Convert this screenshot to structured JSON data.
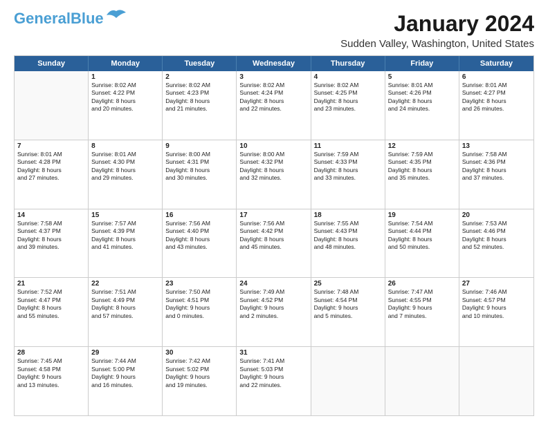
{
  "logo": {
    "line1": "General",
    "line2": "Blue"
  },
  "title": "January 2024",
  "location": "Sudden Valley, Washington, United States",
  "days_of_week": [
    "Sunday",
    "Monday",
    "Tuesday",
    "Wednesday",
    "Thursday",
    "Friday",
    "Saturday"
  ],
  "weeks": [
    [
      {
        "day": "",
        "info": ""
      },
      {
        "day": "1",
        "info": "Sunrise: 8:02 AM\nSunset: 4:22 PM\nDaylight: 8 hours\nand 20 minutes."
      },
      {
        "day": "2",
        "info": "Sunrise: 8:02 AM\nSunset: 4:23 PM\nDaylight: 8 hours\nand 21 minutes."
      },
      {
        "day": "3",
        "info": "Sunrise: 8:02 AM\nSunset: 4:24 PM\nDaylight: 8 hours\nand 22 minutes."
      },
      {
        "day": "4",
        "info": "Sunrise: 8:02 AM\nSunset: 4:25 PM\nDaylight: 8 hours\nand 23 minutes."
      },
      {
        "day": "5",
        "info": "Sunrise: 8:01 AM\nSunset: 4:26 PM\nDaylight: 8 hours\nand 24 minutes."
      },
      {
        "day": "6",
        "info": "Sunrise: 8:01 AM\nSunset: 4:27 PM\nDaylight: 8 hours\nand 26 minutes."
      }
    ],
    [
      {
        "day": "7",
        "info": "Sunrise: 8:01 AM\nSunset: 4:28 PM\nDaylight: 8 hours\nand 27 minutes."
      },
      {
        "day": "8",
        "info": "Sunrise: 8:01 AM\nSunset: 4:30 PM\nDaylight: 8 hours\nand 29 minutes."
      },
      {
        "day": "9",
        "info": "Sunrise: 8:00 AM\nSunset: 4:31 PM\nDaylight: 8 hours\nand 30 minutes."
      },
      {
        "day": "10",
        "info": "Sunrise: 8:00 AM\nSunset: 4:32 PM\nDaylight: 8 hours\nand 32 minutes."
      },
      {
        "day": "11",
        "info": "Sunrise: 7:59 AM\nSunset: 4:33 PM\nDaylight: 8 hours\nand 33 minutes."
      },
      {
        "day": "12",
        "info": "Sunrise: 7:59 AM\nSunset: 4:35 PM\nDaylight: 8 hours\nand 35 minutes."
      },
      {
        "day": "13",
        "info": "Sunrise: 7:58 AM\nSunset: 4:36 PM\nDaylight: 8 hours\nand 37 minutes."
      }
    ],
    [
      {
        "day": "14",
        "info": "Sunrise: 7:58 AM\nSunset: 4:37 PM\nDaylight: 8 hours\nand 39 minutes."
      },
      {
        "day": "15",
        "info": "Sunrise: 7:57 AM\nSunset: 4:39 PM\nDaylight: 8 hours\nand 41 minutes."
      },
      {
        "day": "16",
        "info": "Sunrise: 7:56 AM\nSunset: 4:40 PM\nDaylight: 8 hours\nand 43 minutes."
      },
      {
        "day": "17",
        "info": "Sunrise: 7:56 AM\nSunset: 4:42 PM\nDaylight: 8 hours\nand 45 minutes."
      },
      {
        "day": "18",
        "info": "Sunrise: 7:55 AM\nSunset: 4:43 PM\nDaylight: 8 hours\nand 48 minutes."
      },
      {
        "day": "19",
        "info": "Sunrise: 7:54 AM\nSunset: 4:44 PM\nDaylight: 8 hours\nand 50 minutes."
      },
      {
        "day": "20",
        "info": "Sunrise: 7:53 AM\nSunset: 4:46 PM\nDaylight: 8 hours\nand 52 minutes."
      }
    ],
    [
      {
        "day": "21",
        "info": "Sunrise: 7:52 AM\nSunset: 4:47 PM\nDaylight: 8 hours\nand 55 minutes."
      },
      {
        "day": "22",
        "info": "Sunrise: 7:51 AM\nSunset: 4:49 PM\nDaylight: 8 hours\nand 57 minutes."
      },
      {
        "day": "23",
        "info": "Sunrise: 7:50 AM\nSunset: 4:51 PM\nDaylight: 9 hours\nand 0 minutes."
      },
      {
        "day": "24",
        "info": "Sunrise: 7:49 AM\nSunset: 4:52 PM\nDaylight: 9 hours\nand 2 minutes."
      },
      {
        "day": "25",
        "info": "Sunrise: 7:48 AM\nSunset: 4:54 PM\nDaylight: 9 hours\nand 5 minutes."
      },
      {
        "day": "26",
        "info": "Sunrise: 7:47 AM\nSunset: 4:55 PM\nDaylight: 9 hours\nand 7 minutes."
      },
      {
        "day": "27",
        "info": "Sunrise: 7:46 AM\nSunset: 4:57 PM\nDaylight: 9 hours\nand 10 minutes."
      }
    ],
    [
      {
        "day": "28",
        "info": "Sunrise: 7:45 AM\nSunset: 4:58 PM\nDaylight: 9 hours\nand 13 minutes."
      },
      {
        "day": "29",
        "info": "Sunrise: 7:44 AM\nSunset: 5:00 PM\nDaylight: 9 hours\nand 16 minutes."
      },
      {
        "day": "30",
        "info": "Sunrise: 7:42 AM\nSunset: 5:02 PM\nDaylight: 9 hours\nand 19 minutes."
      },
      {
        "day": "31",
        "info": "Sunrise: 7:41 AM\nSunset: 5:03 PM\nDaylight: 9 hours\nand 22 minutes."
      },
      {
        "day": "",
        "info": ""
      },
      {
        "day": "",
        "info": ""
      },
      {
        "day": "",
        "info": ""
      }
    ]
  ]
}
